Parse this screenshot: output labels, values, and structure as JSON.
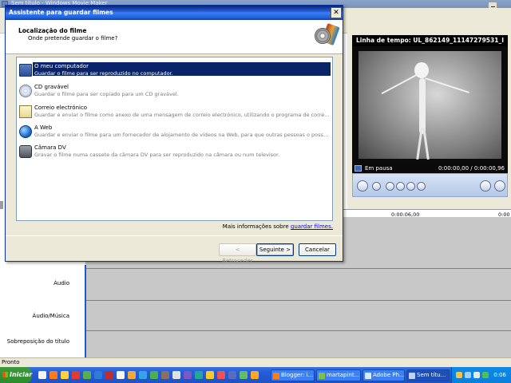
{
  "main_window": {
    "title": "Sem título - Windows Movie Maker",
    "status": "Pronto"
  },
  "preview": {
    "title": "Linha de tempo: UL_862149_11147279531_I",
    "state": "Em pausa",
    "time": "0:00:00,00 / 0:00:00,96"
  },
  "timeline": {
    "ruler_labels": [
      "0:00:06,00",
      "0:00"
    ],
    "tracks": [
      "Áudio",
      "Áudio/Música",
      "Sobreposição do título"
    ]
  },
  "dialog": {
    "title": "Assistente para guardar filmes",
    "header_title": "Localização do filme",
    "header_subtitle": "Onde pretende guardar o filme?",
    "options": [
      {
        "label": "O meu computador",
        "desc": "Guardar o filme para ser reproduzido no computador.",
        "icon": "computer-icon",
        "selected": true
      },
      {
        "label": "CD gravável",
        "desc": "Guardar o filme para ser copiado para um CD gravável.",
        "icon": "cd-icon",
        "selected": false
      },
      {
        "label": "Correio electrónico",
        "desc": "Guardar e enviar o filme como anexo de uma mensagem de correio electrónico, utilizando o programa de correio electrón...",
        "icon": "email-icon",
        "selected": false
      },
      {
        "label": "A Web",
        "desc": "Guardar e enviar o filme para um fornecedor de alojamento de vídeos na Web, para que outras pessoas o possam ver.",
        "icon": "globe-icon",
        "selected": false
      },
      {
        "label": "Câmara DV",
        "desc": "Gravar o filme numa cassete da câmara DV para ser reproduzido na câmara ou num televisor.",
        "icon": "camcorder-icon",
        "selected": false
      }
    ],
    "more_info_prefix": "Mais informações sobre",
    "more_info_link": "guardar filmes.",
    "buttons": {
      "back": "< Retroceder",
      "next": "Seguinte >",
      "cancel": "Cancelar"
    }
  },
  "taskbar": {
    "start": "Iniciar",
    "tasks": [
      {
        "label": "Blogger: i...",
        "active": false
      },
      {
        "label": "martapint...",
        "active": false
      },
      {
        "label": "Adobe Ph...",
        "active": false
      },
      {
        "label": "Sem títu...",
        "active": true
      }
    ],
    "clock": "0:06"
  }
}
